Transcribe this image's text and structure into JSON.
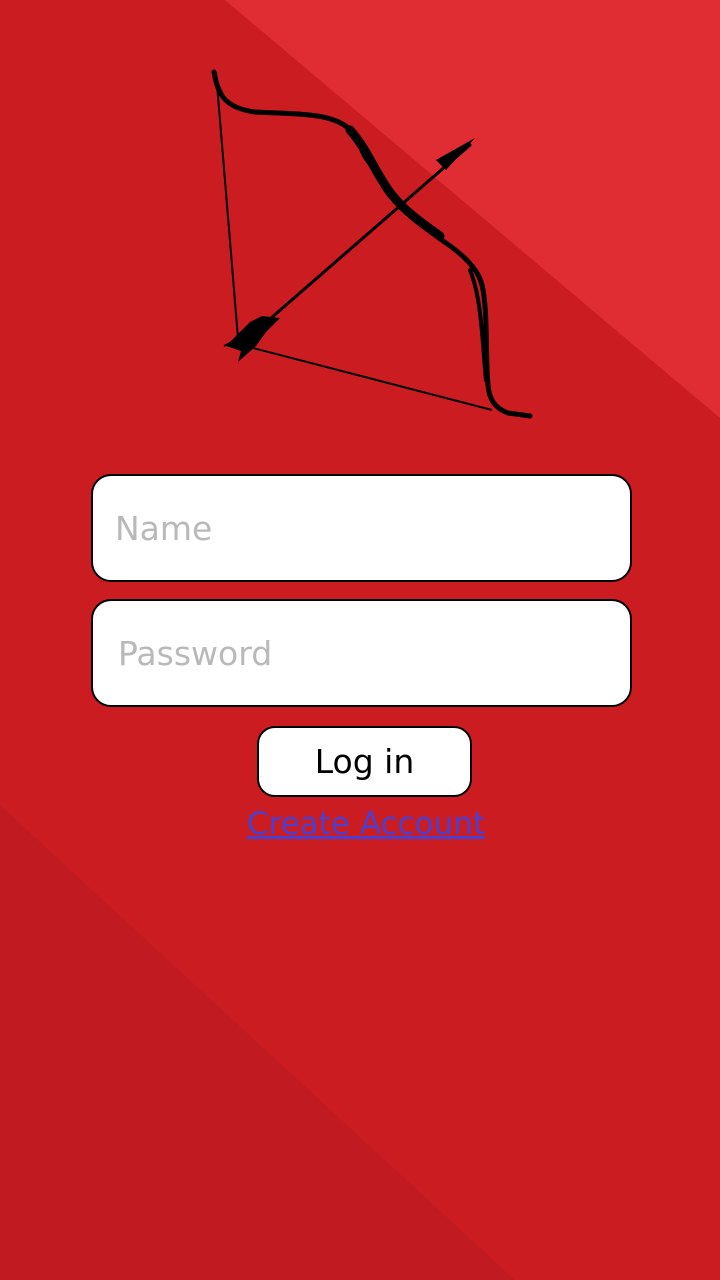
{
  "login": {
    "name_placeholder": "Name",
    "password_placeholder": "Password",
    "login_label": "Log in",
    "create_account_label": "Create Account"
  },
  "icons": {
    "logo": "bow-and-arrow-icon"
  },
  "colors": {
    "background": "#cb1c22",
    "background_light": "#e02d34",
    "background_dark": "#c11b21",
    "link": "#4a3fd0",
    "placeholder": "#b9b9b9"
  }
}
